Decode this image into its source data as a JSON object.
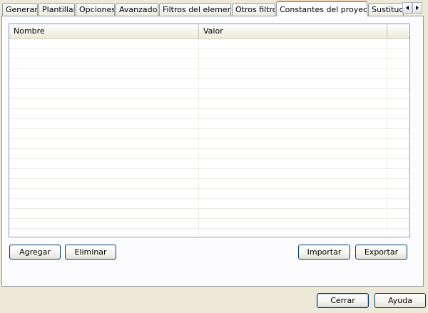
{
  "tabs": [
    {
      "label": "Generar"
    },
    {
      "label": "Plantillas"
    },
    {
      "label": "Opciones"
    },
    {
      "label": "Avanzado"
    },
    {
      "label": "Filtros del elemento"
    },
    {
      "label": "Otros filtros"
    },
    {
      "label": "Constantes del proyecto",
      "active": true
    },
    {
      "label": "Sustitució"
    }
  ],
  "list": {
    "columns": [
      "Nombre",
      "Valor",
      ""
    ],
    "rows": []
  },
  "buttons": {
    "add": "Agregar",
    "remove": "Eliminar",
    "import": "Importar",
    "export": "Exportar",
    "close": "Cerrar",
    "help": "Ayuda"
  }
}
